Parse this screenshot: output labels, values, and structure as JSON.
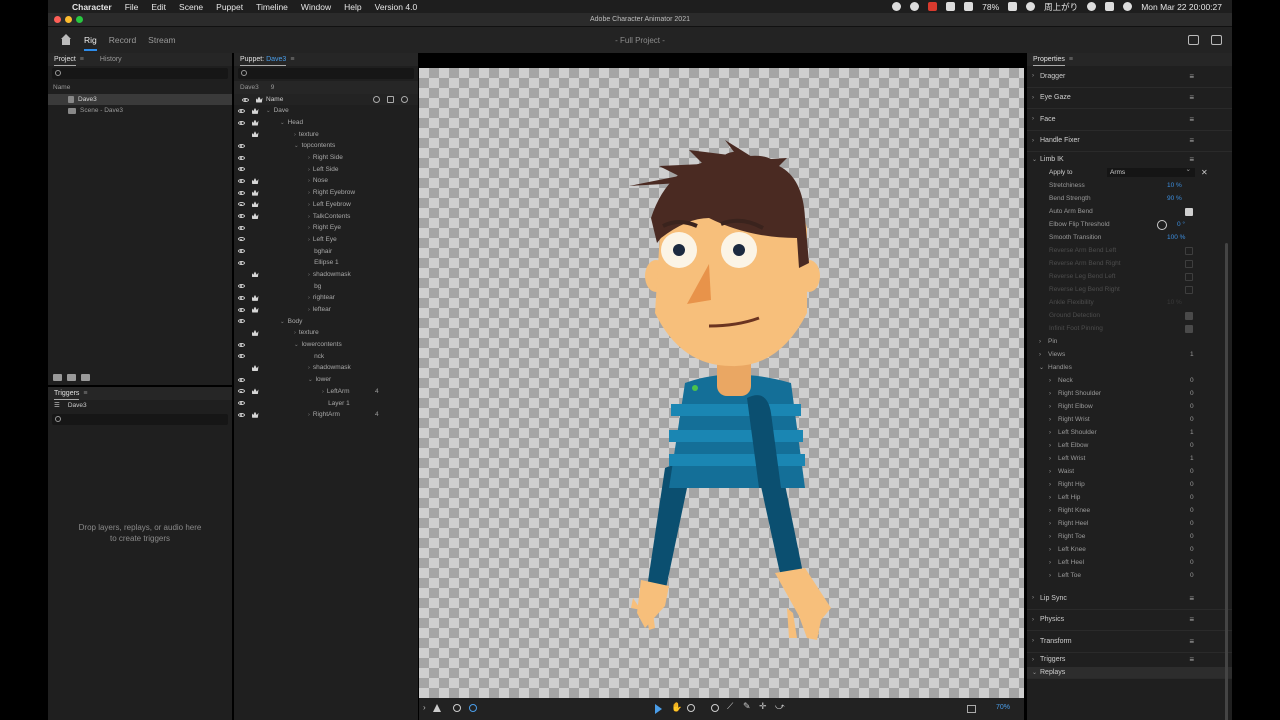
{
  "menubar": {
    "app": "Character",
    "items": [
      "File",
      "Edit",
      "Scene",
      "Puppet",
      "Timeline",
      "Window",
      "Help",
      "Version 4.0"
    ],
    "battery": "78%",
    "ime": "周上がり",
    "datetime": "Mon Mar 22  20:00:27"
  },
  "window": {
    "title": "Adobe Character Animator 2021"
  },
  "toolbar": {
    "modes": [
      "Rig",
      "Record",
      "Stream"
    ],
    "active_mode": "Rig",
    "project_title": "- Full Project -"
  },
  "project_panel": {
    "tabs": [
      "Project",
      "History"
    ],
    "column": "Name",
    "items": [
      "Dave3",
      "Scene - Dave3"
    ]
  },
  "triggers_panel": {
    "title": "Triggers",
    "puppet": "Dave3",
    "hint_line1": "Drop layers, replays, or audio here",
    "hint_line2": "to create triggers"
  },
  "puppet_panel": {
    "title_prefix": "Puppet:",
    "title_name": "Dave3",
    "header_name": "Dave3",
    "header_count": "9",
    "column": "Name",
    "layers": [
      {
        "name": "Dave",
        "indent": 0,
        "twirl": "⌄",
        "eye": true,
        "crown": true
      },
      {
        "name": "Head",
        "indent": 1,
        "twirl": "⌄",
        "eye": true,
        "crown": true
      },
      {
        "name": "texture",
        "indent": 2,
        "twirl": "›",
        "eye": false,
        "crown": true
      },
      {
        "name": "topcontents",
        "indent": 2,
        "twirl": "⌄",
        "eye": true,
        "crown": false
      },
      {
        "name": "Right Side",
        "indent": 3,
        "twirl": "›",
        "eye": true,
        "crown": false
      },
      {
        "name": "Left Side",
        "indent": 3,
        "twirl": "›",
        "eye": true,
        "crown": false
      },
      {
        "name": "Nose",
        "indent": 3,
        "twirl": "›",
        "eye": true,
        "crown": true
      },
      {
        "name": "Right Eyebrow",
        "indent": 3,
        "twirl": "›",
        "eye": true,
        "crown": true
      },
      {
        "name": "Left Eyebrow",
        "indent": 3,
        "twirl": "›",
        "eye": true,
        "crown": true
      },
      {
        "name": "TalkContents",
        "indent": 3,
        "twirl": "›",
        "eye": true,
        "crown": true
      },
      {
        "name": "Right Eye",
        "indent": 3,
        "twirl": "›",
        "eye": true,
        "crown": false
      },
      {
        "name": "Left Eye",
        "indent": 3,
        "twirl": "›",
        "eye": true,
        "crown": false
      },
      {
        "name": "bghair",
        "indent": 3,
        "twirl": "",
        "eye": true,
        "crown": false
      },
      {
        "name": "Ellipse 1",
        "indent": 3,
        "twirl": "",
        "eye": true,
        "crown": false
      },
      {
        "name": "shadowmask",
        "indent": 3,
        "twirl": "›",
        "eye": false,
        "crown": true
      },
      {
        "name": "bg",
        "indent": 3,
        "twirl": "",
        "eye": true,
        "crown": false
      },
      {
        "name": "rightear",
        "indent": 3,
        "twirl": "›",
        "eye": true,
        "crown": true
      },
      {
        "name": "leftear",
        "indent": 3,
        "twirl": "›",
        "eye": true,
        "crown": true
      },
      {
        "name": "Body",
        "indent": 1,
        "twirl": "⌄",
        "eye": true,
        "crown": false
      },
      {
        "name": "texture",
        "indent": 2,
        "twirl": "›",
        "eye": false,
        "crown": true
      },
      {
        "name": "lowercontents",
        "indent": 2,
        "twirl": "⌄",
        "eye": true,
        "crown": false
      },
      {
        "name": "nck",
        "indent": 3,
        "twirl": "",
        "eye": true,
        "crown": false
      },
      {
        "name": "shadowmask",
        "indent": 3,
        "twirl": "›",
        "eye": false,
        "crown": true
      },
      {
        "name": "lower",
        "indent": 3,
        "twirl": "⌄",
        "eye": true,
        "crown": false
      },
      {
        "name": "LeftArm",
        "indent": 4,
        "twirl": "›",
        "eye": true,
        "crown": true,
        "count": "4"
      },
      {
        "name": "Layer 1",
        "indent": 4,
        "twirl": "",
        "eye": true,
        "crown": false
      },
      {
        "name": "RightArm",
        "indent": 3,
        "twirl": "›",
        "eye": true,
        "crown": true,
        "count": "4"
      }
    ]
  },
  "stage": {
    "zoom": "70%"
  },
  "properties": {
    "title": "Properties",
    "sections_top": [
      "Dragger",
      "Eye Gaze",
      "Face",
      "Handle Fixer"
    ],
    "limb_ik": {
      "title": "Limb IK",
      "apply_to_label": "Apply to",
      "apply_to_value": "Arms",
      "stretchiness_label": "Stretchiness",
      "stretchiness_value": "10 %",
      "bend_strength_label": "Bend Strength",
      "bend_strength_value": "90 %",
      "auto_arm_bend_label": "Auto Arm Bend",
      "elbow_flip_label": "Elbow Flip Threshold",
      "elbow_flip_value": "0 °",
      "smooth_transition_label": "Smooth Transition",
      "smooth_transition_value": "100 %",
      "disabled": [
        {
          "label": "Reverse Arm Bend Left",
          "checked": false
        },
        {
          "label": "Reverse Arm Bend Right",
          "checked": false
        },
        {
          "label": "Reverse Leg Bend Left",
          "checked": false
        },
        {
          "label": "Reverse Leg Bend Right",
          "checked": false
        },
        {
          "label": "Ankle Flexibility",
          "value": "10 %"
        },
        {
          "label": "Ground Detection",
          "checked": true
        },
        {
          "label": "Infinit Foot Pinning",
          "checked": true
        }
      ],
      "pin_label": "Pin",
      "views_label": "Views",
      "views_count": "1",
      "handles_label": "Handles",
      "handles": [
        {
          "name": "Neck",
          "count": "0"
        },
        {
          "name": "Right Shoulder",
          "count": "0"
        },
        {
          "name": "Right Elbow",
          "count": "0"
        },
        {
          "name": "Right Wrist",
          "count": "0"
        },
        {
          "name": "Left Shoulder",
          "count": "1"
        },
        {
          "name": "Left Elbow",
          "count": "0"
        },
        {
          "name": "Left Wrist",
          "count": "1"
        },
        {
          "name": "Waist",
          "count": "0"
        },
        {
          "name": "Right Hip",
          "count": "0"
        },
        {
          "name": "Left Hip",
          "count": "0"
        },
        {
          "name": "Right Knee",
          "count": "0"
        },
        {
          "name": "Right Heel",
          "count": "0"
        },
        {
          "name": "Right Toe",
          "count": "0"
        },
        {
          "name": "Left Knee",
          "count": "0"
        },
        {
          "name": "Left Heel",
          "count": "0"
        },
        {
          "name": "Left Toe",
          "count": "0"
        }
      ]
    },
    "sections_bottom": [
      "Lip Sync",
      "Physics",
      "Transform",
      "Triggers"
    ],
    "replays": "Replays"
  },
  "colors": {
    "accent": "#2d8ceb",
    "value_blue": "#3d8fe0",
    "shirt_dark": "#0b5a7e",
    "shirt_light": "#1a85b2",
    "skin": "#f7bf7b",
    "hair": "#4a2a22"
  }
}
